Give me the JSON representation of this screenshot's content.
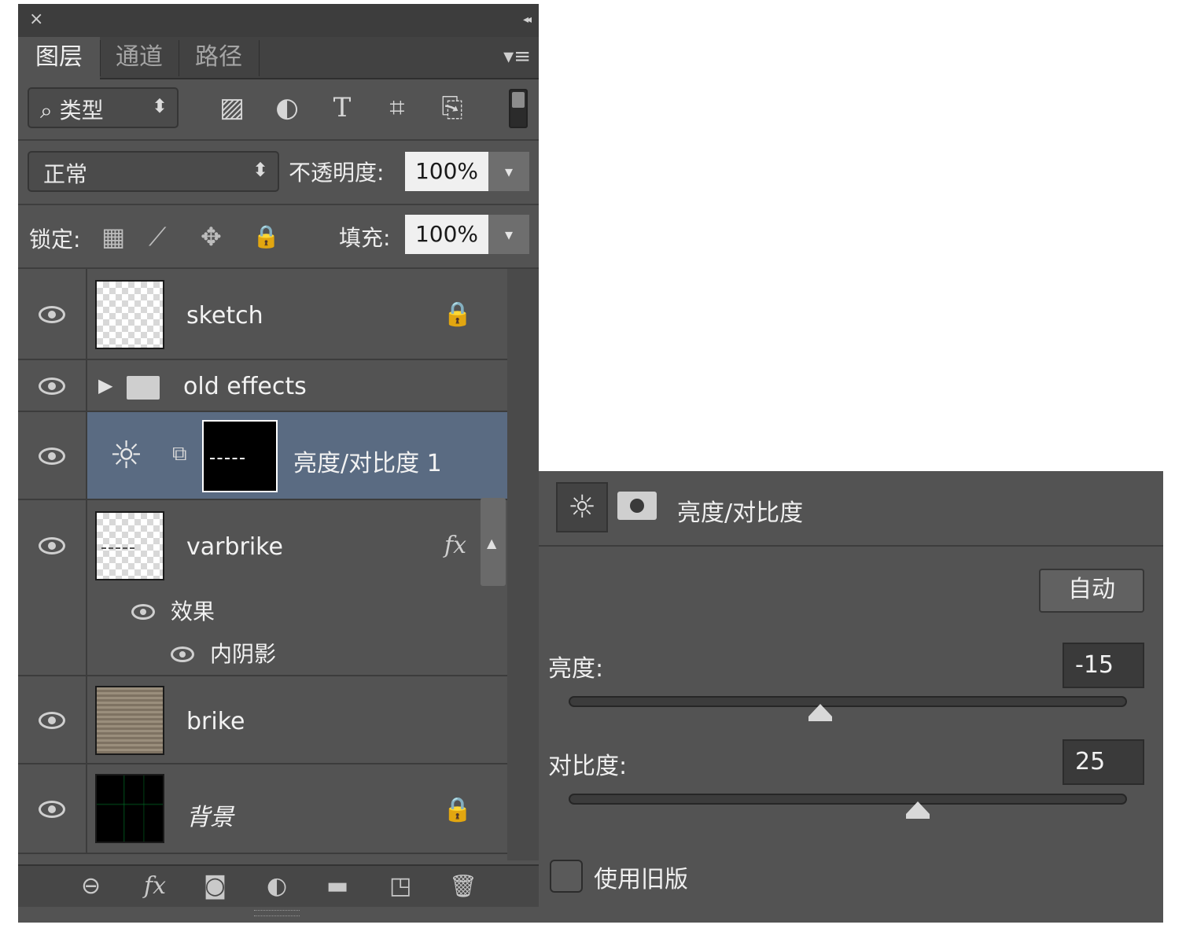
{
  "layers_panel": {
    "close_glyph": "×",
    "collapse_glyph": "◂◂",
    "tabs": [
      {
        "label": "图层",
        "active": true
      },
      {
        "label": "通道",
        "active": false
      },
      {
        "label": "路径",
        "active": false
      }
    ],
    "menu_glyph": "▾≡",
    "filter": {
      "kind_label": "⌕ 类型",
      "arrow": "⬍",
      "icons": [
        {
          "name": "image-filter-icon",
          "glyph": "▨"
        },
        {
          "name": "adjustment-filter-icon",
          "glyph": "◐"
        },
        {
          "name": "type-filter-icon",
          "glyph": "T"
        },
        {
          "name": "shape-filter-icon",
          "glyph": "⌗"
        },
        {
          "name": "smart-object-filter-icon",
          "glyph": "⎘"
        }
      ]
    },
    "blend_mode": {
      "value": "正常",
      "arrow": "⬍"
    },
    "opacity": {
      "label": "不透明度:",
      "value": "100%",
      "arrow": "▾"
    },
    "lock": {
      "label": "锁定:",
      "icons": [
        {
          "name": "lock-transparent-pixels-icon",
          "glyph": "▦"
        },
        {
          "name": "lock-image-pixels-icon",
          "glyph": "⟋"
        },
        {
          "name": "lock-position-icon",
          "glyph": "✥"
        },
        {
          "name": "lock-all-icon",
          "glyph": "🔒"
        }
      ]
    },
    "fill": {
      "label": "填充:",
      "value": "100%",
      "arrow": "▾"
    },
    "layers": [
      {
        "name": "sketch",
        "locked_glyph": "🔒"
      },
      {
        "name": "old effects",
        "expand_glyph": "▶"
      },
      {
        "name": "亮度/对比度 1",
        "adjustment_glyph": "☼",
        "link_glyph": "⧉",
        "selected": true
      },
      {
        "name": "varbrike",
        "fx_glyph": "fx",
        "effects_label": "效果",
        "effect_item": "内阴影"
      },
      {
        "name": "brike"
      },
      {
        "name": "背景",
        "locked_glyph": "🔒"
      }
    ],
    "scroll_up_glyph": "▲",
    "bottom_icons": [
      {
        "name": "link-layers-icon",
        "glyph": "⊖"
      },
      {
        "name": "add-layer-style-icon",
        "glyph": "fx"
      },
      {
        "name": "add-mask-icon",
        "glyph": "◙"
      },
      {
        "name": "new-adjustment-layer-icon",
        "glyph": "◐"
      },
      {
        "name": "new-group-icon",
        "glyph": "▬"
      },
      {
        "name": "new-layer-icon",
        "glyph": "◳"
      },
      {
        "name": "delete-layer-icon",
        "glyph": "🗑"
      }
    ]
  },
  "properties_panel": {
    "adjustment_icon_glyph": "☼",
    "title": "亮度/对比度",
    "auto_label": "自动",
    "brightness": {
      "label": "亮度:",
      "value": "-15",
      "slider_fraction": 0.45
    },
    "contrast": {
      "label": "对比度:",
      "value": "25",
      "slider_fraction": 0.625
    },
    "legacy_label": "使用旧版"
  },
  "colors": {
    "panel_bg": "#535353",
    "selected_row": "#5a6b82",
    "field_bg": "#f0f0f0"
  }
}
